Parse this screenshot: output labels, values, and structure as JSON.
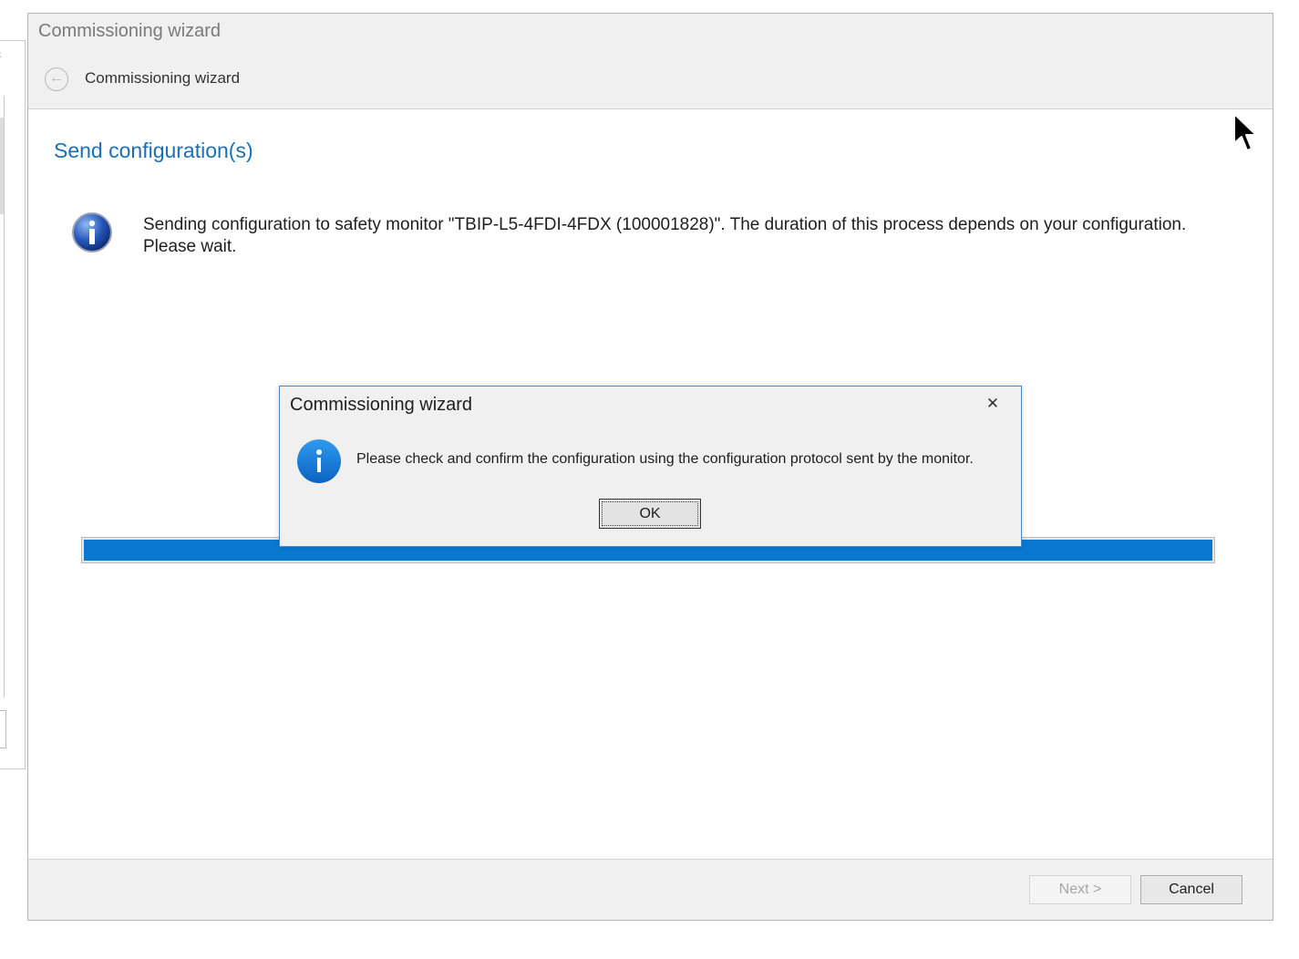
{
  "wizard": {
    "window_title": "Commissioning wizard",
    "subtitle": "Commissioning wizard",
    "page_heading": "Send configuration(s)",
    "status_message": "Sending configuration to safety monitor \"TBIP-L5-4FDI-4FDX (100001828)\". The duration of this process depends on your configuration. Please wait.",
    "progress_fraction": 1.0,
    "footer": {
      "next_label": "Next >",
      "cancel_label": "Cancel"
    },
    "icons": {
      "back": "back-arrow-icon",
      "status": "info-icon"
    }
  },
  "dialog": {
    "title": "Commissioning wizard",
    "close_glyph": "✕",
    "message": "Please check and confirm the configuration using the configuration protocol sent by the monitor.",
    "ok_label": "OK",
    "icon": "info-icon"
  },
  "colors": {
    "heading": "#1a6fb5",
    "progress": "#0a78d1",
    "dialog_border": "#4a88c7"
  }
}
